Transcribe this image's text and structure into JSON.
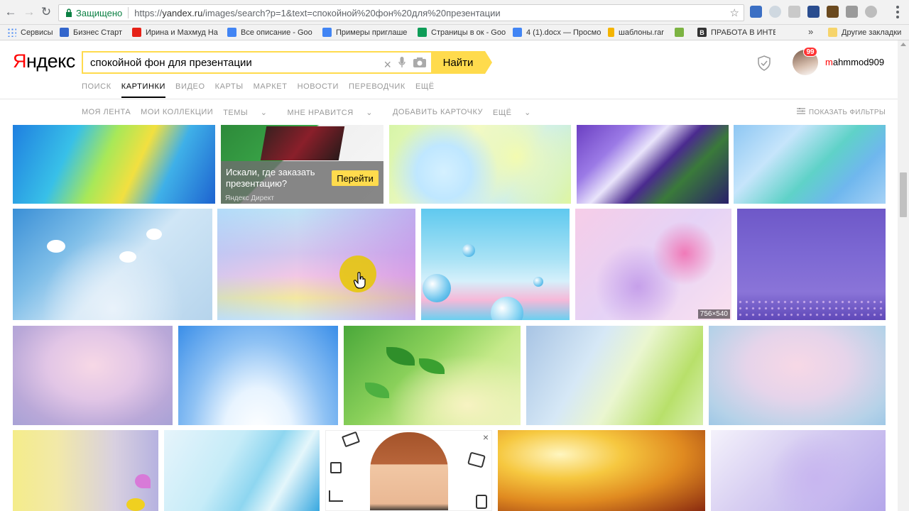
{
  "browser": {
    "secure_label": "Защищено",
    "url_scheme": "https://",
    "url_host": "yandex.ru",
    "url_path": "/images/search?p=1&text=спокойной%20фон%20для%20презентации"
  },
  "bookmarks": {
    "items": [
      {
        "label": "Сервисы",
        "color": "#4285f4"
      },
      {
        "label": "Бизнес Старт",
        "color": "#3366cc"
      },
      {
        "label": "Ирина и Махмуд На",
        "color": "#e62117"
      },
      {
        "label": "Все описание - Goo",
        "color": "#4285f4"
      },
      {
        "label": "Примеры приглаше",
        "color": "#4285f4"
      },
      {
        "label": "Страницы в ок - Goo",
        "color": "#0f9d58"
      },
      {
        "label": "4 (1).docx — Просмо",
        "color": "#4285f4"
      },
      {
        "label": "шаблоны.rar",
        "color": "#f4b400"
      },
      {
        "label": "",
        "color": "#7cb342"
      },
      {
        "label": "ПРАБОТА В ИНТЕРН",
        "color": "#333333"
      }
    ],
    "more": "»",
    "other": "Другие закладки"
  },
  "header": {
    "logo_first": "Я",
    "logo_rest": "ндекс",
    "search_value": "спокойной фон для презентации",
    "search_button": "Найти",
    "username_first": "m",
    "username_rest": "ahmmod909",
    "badge": "99"
  },
  "services": [
    "ПОИСК",
    "КАРТИНКИ",
    "ВИДЕО",
    "КАРТЫ",
    "МАРКЕТ",
    "НОВОСТИ",
    "ПЕРЕВОДЧИК",
    "ЕЩЁ"
  ],
  "subnav": {
    "items": [
      "МОЯ ЛЕНТА",
      "МОИ КОЛЛЕКЦИИ",
      "ТЕМЫ",
      "МНЕ НРАВИТСЯ",
      "ДОБАВИТЬ КАРТОЧКУ",
      "ЕЩЁ"
    ],
    "filters": "ПОКАЗАТЬ ФИЛЬТРЫ"
  },
  "ad": {
    "text": "Искали, где заказать презентацию?",
    "button": "Перейти",
    "label": "Яндекс Директ"
  },
  "size_label": "756×540",
  "ad_close": "×"
}
